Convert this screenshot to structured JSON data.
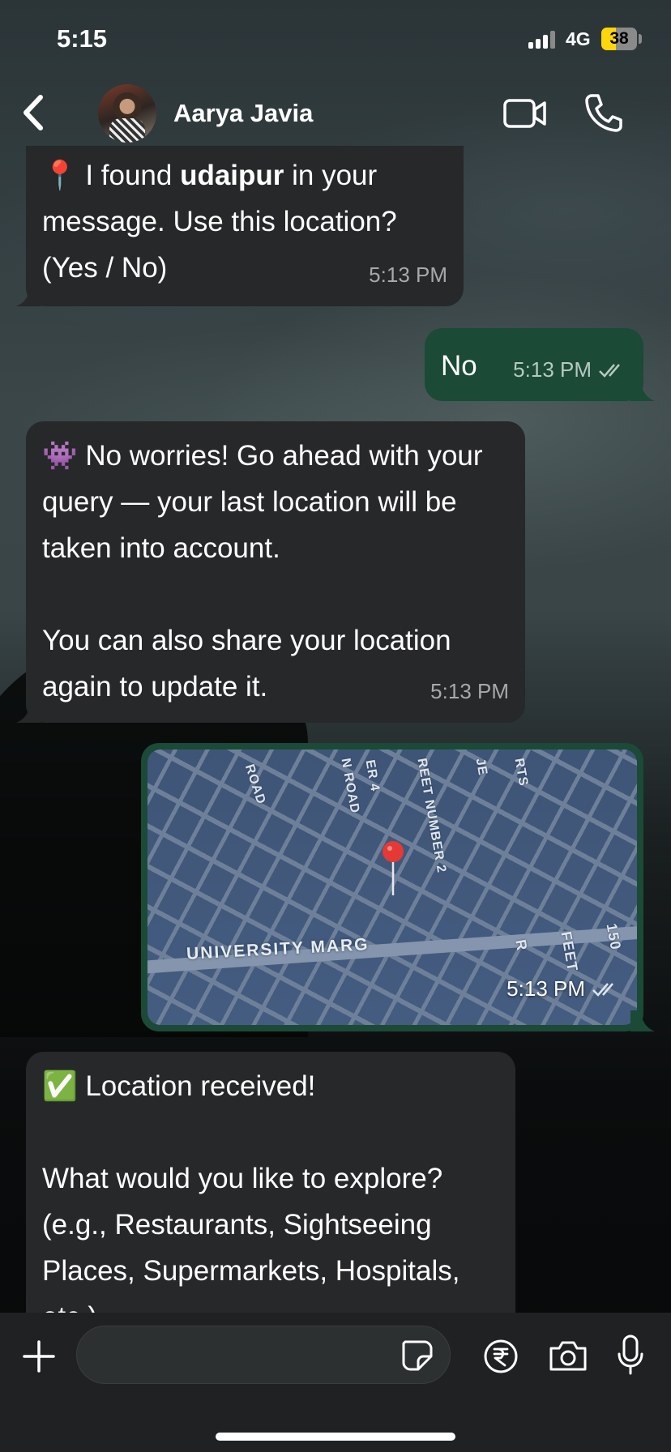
{
  "status_bar": {
    "time": "5:15",
    "network": "4G",
    "battery": "38"
  },
  "header": {
    "contact_name": "Aarya Javia"
  },
  "messages": [
    {
      "direction": "incoming",
      "emoji": "📍",
      "text_before": " I found ",
      "bold": "udaipur",
      "text_after": " in your message. Use this location? (Yes / No)",
      "time": "5:13 PM"
    },
    {
      "direction": "outgoing",
      "text": "No",
      "time": "5:13 PM",
      "status": "read"
    },
    {
      "direction": "incoming",
      "emoji": "👾",
      "text": " No worries! Go ahead with your query — your last location will be taken into account.\n\nYou can also share your location again to update it.",
      "time": "5:13 PM"
    },
    {
      "direction": "outgoing",
      "type": "location",
      "map_labels": [
        "ROAD",
        "N ROAD",
        "ER 4",
        "REET NUMBER 2",
        "JE",
        "RTS",
        "UNIVERSITY MARG",
        "150 FEET R"
      ],
      "time": "5:13 PM",
      "status": "read"
    },
    {
      "direction": "incoming",
      "emoji": "✅",
      "text": " Location received!\n\nWhat would you like to explore? (e.g., Restaurants, Sightseeing Places, Supermarkets, Hospitals, etc.)"
    }
  ],
  "composer": {
    "placeholder": ""
  },
  "colors": {
    "incoming_bubble": "#262829",
    "outgoing_bubble": "#1b4a37",
    "header_bg": "#2b3538",
    "composer_bg": "#1f2122"
  },
  "icons": [
    "back-chevron-icon",
    "video-call-icon",
    "phone-call-icon",
    "plus-icon",
    "sticker-icon",
    "rupee-payment-icon",
    "camera-icon",
    "microphone-icon",
    "read-receipt-icon",
    "map-pin-icon"
  ]
}
